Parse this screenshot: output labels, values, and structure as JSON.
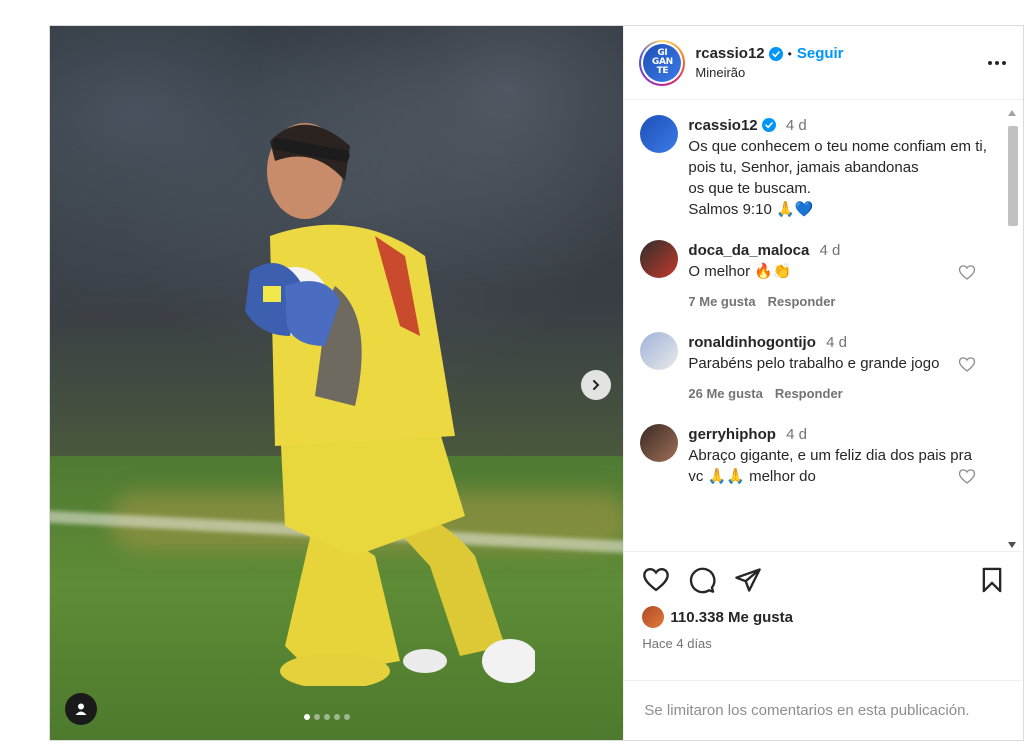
{
  "post": {
    "image_alt": "Goalkeeper in yellow kit kneeling on the pitch holding the ball",
    "carousel": {
      "total": 5,
      "current": 1
    }
  },
  "header": {
    "username": "rcassio12",
    "separator": "•",
    "follow_label": "Seguir",
    "location": "Mineirão",
    "avatar_text": [
      "GI",
      "GAN",
      "TE"
    ]
  },
  "caption": {
    "username": "rcassio12",
    "time": "4 d",
    "text": "Os que conhecem o teu nome confiam em ti,\npois tu, Senhor, jamais abandonas\nos que te buscam.\nSalmos 9:10 🙏💙"
  },
  "comments": [
    {
      "username": "doca_da_maloca",
      "time": "4 d",
      "text": "O melhor 🔥👏",
      "likes": "7 Me gusta",
      "reply": "Responder"
    },
    {
      "username": "ronaldinhogontijo",
      "time": "4 d",
      "text": "Parabéns pelo trabalho e grande jogo",
      "likes": "26 Me gusta",
      "reply": "Responder"
    },
    {
      "username": "gerryhiphop",
      "time": "4 d",
      "text": "Abraço gigante, e um feliz dia dos pais pra vc 🙏🙏 melhor do",
      "likes": "",
      "reply": ""
    }
  ],
  "actions": {
    "likes_count": "110.338 Me gusta",
    "posted": "Hace 4 días"
  },
  "footer": {
    "limited_text": "Se limitaron los comentarios en esta publicación."
  },
  "colors": {
    "accent": "#0095f6",
    "text": "#262626",
    "muted": "#737373",
    "border": "#dbdbdb"
  }
}
